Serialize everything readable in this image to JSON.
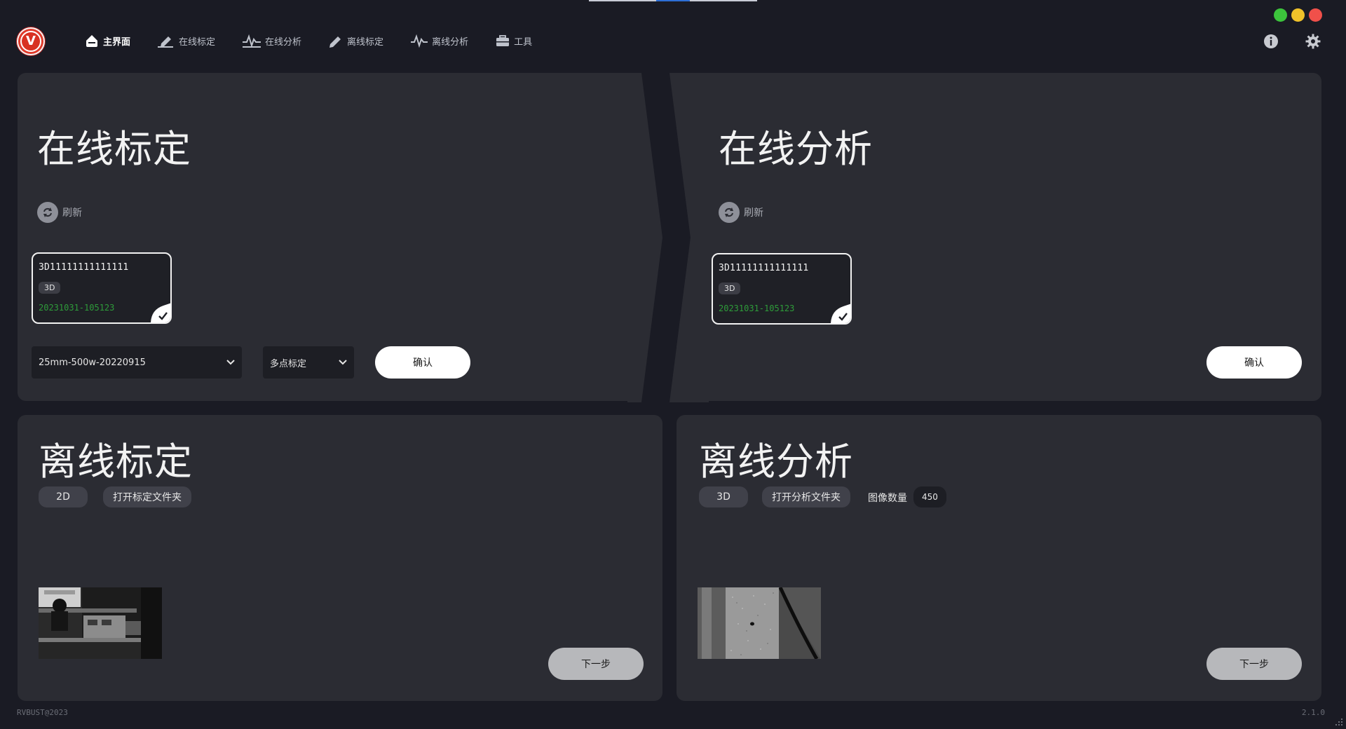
{
  "header": {
    "logo_letter": "V",
    "nav": [
      {
        "label": "主界面",
        "icon": "home-icon"
      },
      {
        "label": "在线标定",
        "icon": "online-calibration-icon"
      },
      {
        "label": "在线分析",
        "icon": "online-analysis-icon"
      },
      {
        "label": "离线标定",
        "icon": "offline-calibration-icon"
      },
      {
        "label": "离线分析",
        "icon": "offline-analysis-icon"
      },
      {
        "label": "工具",
        "icon": "toolbox-icon"
      }
    ],
    "right_icons": [
      "info-icon",
      "settings-icon"
    ]
  },
  "colors": {
    "background": "#1a1b24",
    "card": "#2b2c33",
    "accent_blue": "#2d6fd6",
    "date_green": "#2e9c3a",
    "win_green": "#3cc43c",
    "win_yellow": "#f0c22a",
    "win_red": "#f0504a"
  },
  "online_calibration": {
    "title": "在线标定",
    "refresh_label": "刷新",
    "device": {
      "id": "3D11111111111111",
      "tag": "3D",
      "date": "20231031-105123",
      "selected": true
    },
    "lens_select": "25mm-500w-20220915",
    "mode_select": "多点标定",
    "confirm_label": "确认"
  },
  "online_analysis": {
    "title": "在线分析",
    "refresh_label": "刷新",
    "device": {
      "id": "3D11111111111111",
      "tag": "3D",
      "date": "20231031-105123",
      "selected": true
    },
    "confirm_label": "确认"
  },
  "offline_calibration": {
    "title": "离线标定",
    "mode_pill": "2D",
    "open_folder_label": "打开标定文件夹",
    "next_label": "下一步"
  },
  "offline_analysis": {
    "title": "离线分析",
    "mode_pill": "3D",
    "open_folder_label": "打开分析文件夹",
    "image_count_label": "图像数量",
    "image_count": "450",
    "next_label": "下一步"
  },
  "footer": {
    "copyright": "RVBUST@2023",
    "version": "2.1.0"
  }
}
